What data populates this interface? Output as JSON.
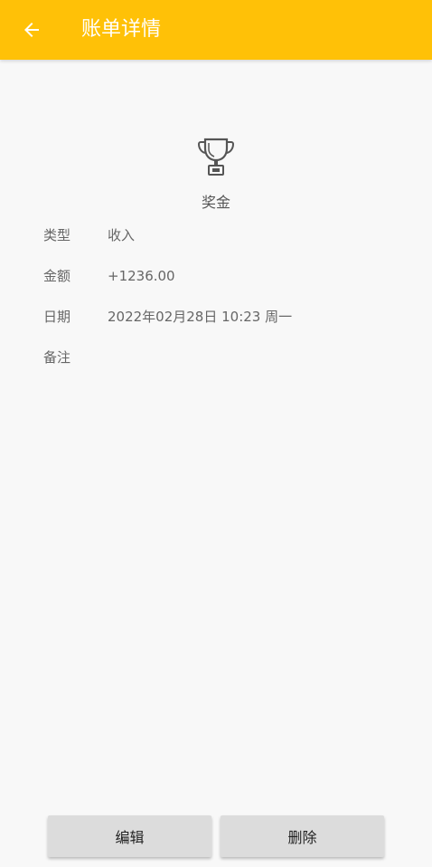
{
  "header": {
    "title": "账单详情",
    "accent_color": "#ffc107",
    "back_icon": "arrow-left-icon"
  },
  "category": {
    "icon": "trophy-icon",
    "label": "奖金"
  },
  "details": [
    {
      "label": "类型",
      "value": "收入"
    },
    {
      "label": "金额",
      "value": "+1236.00"
    },
    {
      "label": "日期",
      "value": "2022年02月28日 10:23 周一"
    },
    {
      "label": "备注",
      "value": ""
    }
  ],
  "actions": {
    "edit_label": "编辑",
    "delete_label": "删除"
  }
}
